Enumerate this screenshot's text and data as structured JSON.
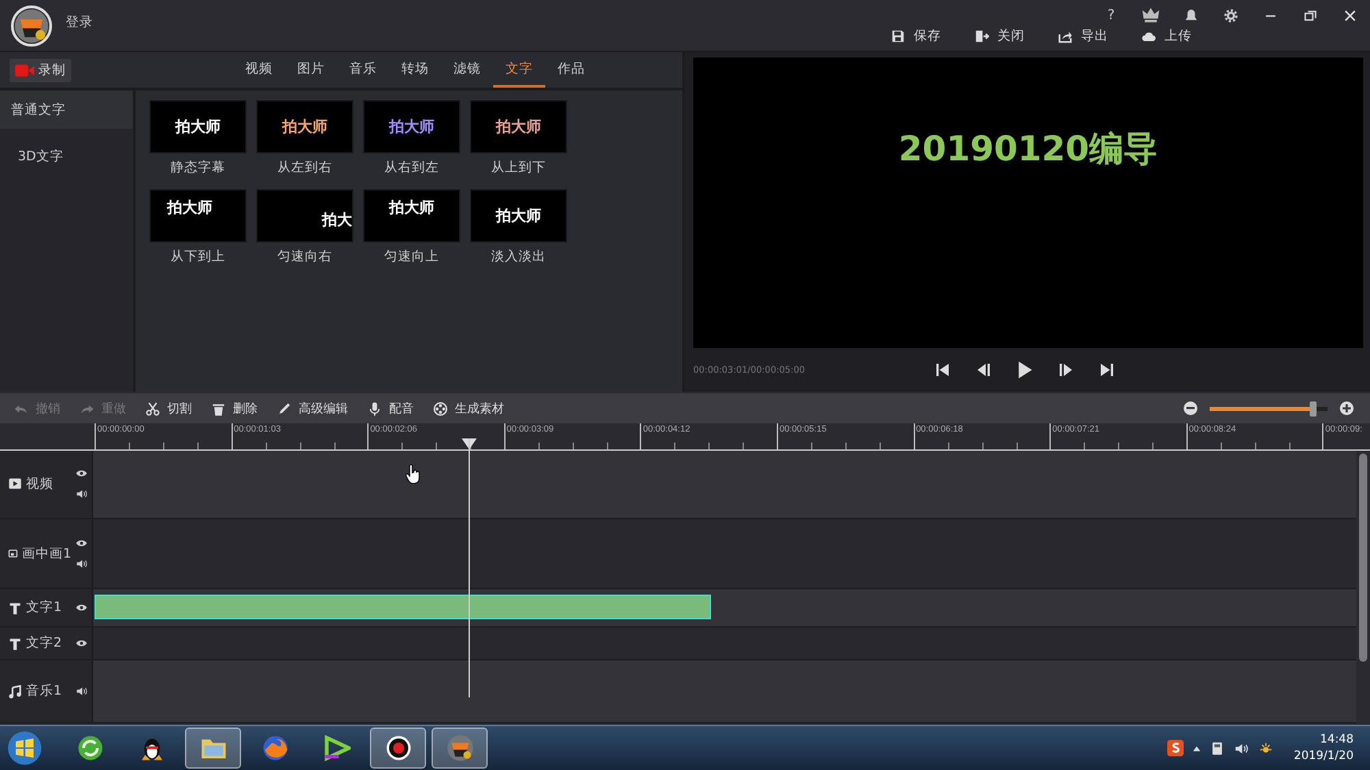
{
  "header": {
    "login": "登录"
  },
  "window_controls": [
    {
      "kind": "help",
      "label": "?"
    },
    {
      "kind": "vip"
    },
    {
      "kind": "bell"
    },
    {
      "kind": "settings"
    },
    {
      "kind": "minimize"
    },
    {
      "kind": "restore"
    },
    {
      "kind": "close"
    }
  ],
  "actions": [
    {
      "kind": "save",
      "label": "保存"
    },
    {
      "kind": "exit",
      "label": "关闭"
    },
    {
      "kind": "export",
      "label": "导出"
    },
    {
      "kind": "upload",
      "label": "上传"
    }
  ],
  "record_button": "录制",
  "tabs": [
    {
      "label": "视频",
      "selected": false
    },
    {
      "label": "图片",
      "selected": false
    },
    {
      "label": "音乐",
      "selected": false
    },
    {
      "label": "转场",
      "selected": false
    },
    {
      "label": "滤镜",
      "selected": false
    },
    {
      "label": "文字",
      "selected": true
    },
    {
      "label": "作品",
      "selected": false
    }
  ],
  "sidebar": {
    "items": [
      {
        "label": "普通文字",
        "selected": true
      },
      {
        "label": "3D文字",
        "selected": false
      }
    ]
  },
  "templates": [
    {
      "label": "静态字幕",
      "preview": "拍大师",
      "color": "#ffffff",
      "kind": "center"
    },
    {
      "label": "从左到右",
      "preview": "拍大师",
      "color": "#f4a56e",
      "kind": "center"
    },
    {
      "label": "从右到左",
      "preview": "拍大师",
      "color": "#a08cff",
      "kind": "center"
    },
    {
      "label": "从上到下",
      "preview": "拍大师",
      "color": "#e8a090",
      "kind": "center"
    },
    {
      "label": "从下到上",
      "preview": "拍大师",
      "color": "#ffffff",
      "kind": "topleft"
    },
    {
      "label": "匀速向右",
      "preview": "拍大",
      "color": "#ffffff",
      "kind": "right"
    },
    {
      "label": "匀速向上",
      "preview": "拍大师",
      "color": "#ffffff",
      "kind": "top"
    },
    {
      "label": "淡入淡出",
      "preview": "拍大师",
      "color": "#ffffff",
      "kind": "center"
    }
  ],
  "preview": {
    "caption": "20190120编导",
    "time": "00:00:03:01/00:00:05:00"
  },
  "playback_controls": [
    {
      "kind": "first"
    },
    {
      "kind": "back"
    },
    {
      "kind": "play"
    },
    {
      "kind": "forward"
    },
    {
      "kind": "last"
    }
  ],
  "toolbar": [
    {
      "kind": "undo",
      "label": "撤销",
      "disabled": true
    },
    {
      "kind": "redo",
      "label": "重做",
      "disabled": true
    },
    {
      "kind": "cut",
      "label": "切割",
      "disabled": false
    },
    {
      "kind": "delete",
      "label": "删除",
      "disabled": false
    },
    {
      "kind": "edit",
      "label": "高级编辑",
      "disabled": false
    },
    {
      "kind": "dub",
      "label": "配音",
      "disabled": false
    },
    {
      "kind": "generate",
      "label": "生成素材",
      "disabled": false
    }
  ],
  "zoom": {
    "level": 0.88
  },
  "ruler": {
    "ticks": [
      "00:00:00:00",
      "00:00:01:03",
      "00:00:02:06",
      "00:00:03:09",
      "00:00:04:12",
      "00:00:05:15",
      "00:00:06:18",
      "00:00:07:21",
      "00:00:08:24",
      "00:00:09:"
    ]
  },
  "tracks": [
    {
      "kind": "video",
      "label": "视频",
      "controls": [
        {
          "kind": "eye"
        },
        {
          "kind": "sound"
        }
      ],
      "clip": false
    },
    {
      "kind": "pip",
      "label": "画中画1",
      "controls": [
        {
          "kind": "eye"
        },
        {
          "kind": "sound"
        }
      ],
      "clip": false
    },
    {
      "kind": "text",
      "label": "文字1",
      "controls": [
        {
          "kind": "eye"
        }
      ],
      "clip": true
    },
    {
      "kind": "text",
      "label": "文字2",
      "controls": [
        {
          "kind": "eye"
        }
      ],
      "clip": false
    },
    {
      "kind": "music",
      "label": "音乐1",
      "controls": [
        {
          "kind": "sound"
        }
      ],
      "clip": false
    }
  ],
  "taskbar": {
    "apps": [
      {
        "kind": "refresh",
        "active": false
      },
      {
        "kind": "penguin",
        "active": false
      },
      {
        "kind": "folder",
        "active": true
      },
      {
        "kind": "browser",
        "active": false
      },
      {
        "kind": "triangle",
        "active": false
      },
      {
        "kind": "record",
        "active": true
      },
      {
        "kind": "logo",
        "active": true
      }
    ],
    "tray": {
      "time": "14:48",
      "date": "2019/1/20"
    }
  }
}
